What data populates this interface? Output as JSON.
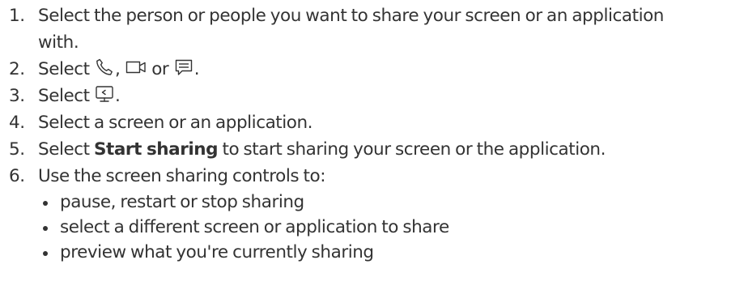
{
  "steps": [
    {
      "number": "1.",
      "line1": "Select the person or people you want to share your screen or an application",
      "line2": "with."
    },
    {
      "number": "2.",
      "prefix": "Select",
      "sep1": ",",
      "sep2": "or",
      "suffix": ".",
      "icons": [
        "phone-icon",
        "video-camera-icon",
        "chat-icon"
      ]
    },
    {
      "number": "3.",
      "prefix": "Select",
      "suffix": ".",
      "icons": [
        "share-screen-icon"
      ]
    },
    {
      "number": "4.",
      "text": "Select a screen or an application."
    },
    {
      "number": "5.",
      "prefix": "Select ",
      "bold": "Start sharing",
      "suffix": " to start sharing your screen or the application."
    },
    {
      "number": "6.",
      "text": "Use the screen sharing controls to:",
      "subitems": [
        "pause, restart or stop sharing",
        "select a different screen or application to share",
        "preview what you're currently sharing"
      ]
    }
  ],
  "colors": {
    "text": "#333333",
    "background": "#ffffff"
  }
}
